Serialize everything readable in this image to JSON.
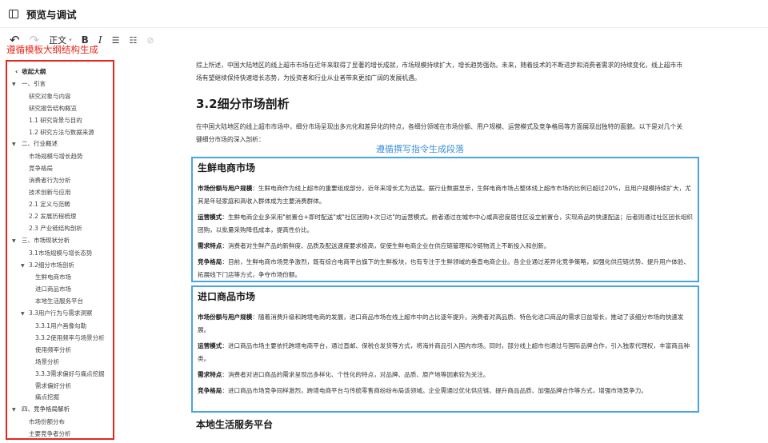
{
  "window": {
    "title": "预览与调试"
  },
  "toolbar": {
    "undo": "↶",
    "redo": "↷",
    "style_label": "正文",
    "style_caret": "▾",
    "bold": "B",
    "italic": "I",
    "bullet_list": "☰",
    "ordered_list": "☷",
    "link": "⊘"
  },
  "annotations": {
    "outline_note": "遵循模板大纲结构生成",
    "paragraph_note": "遵循撰写指令生成段落"
  },
  "outline": {
    "collapse_label": "收起大纲",
    "items": [
      {
        "level": "l1",
        "arrow": "▼",
        "label": "一、引言"
      },
      {
        "level": "l2",
        "label": "研究对象与内容"
      },
      {
        "level": "l2",
        "label": "研究报告结构概览"
      },
      {
        "level": "l2",
        "label": "1.1 研究背景与目的"
      },
      {
        "level": "l2",
        "label": "1.2 研究方法与数据来源"
      },
      {
        "level": "l1",
        "arrow": "▼",
        "label": "二、行业概述"
      },
      {
        "level": "l2",
        "label": "市场规模与增长趋势"
      },
      {
        "level": "l2",
        "label": "竞争格局"
      },
      {
        "level": "l2",
        "label": "消费者行为分析"
      },
      {
        "level": "l2",
        "label": "技术创新与应用"
      },
      {
        "level": "l2",
        "label": "2.1 定义与范畴"
      },
      {
        "level": "l2",
        "label": "2.2 发展历程梳理"
      },
      {
        "level": "l2",
        "label": "2.3 产业链结构剖析"
      },
      {
        "level": "l1",
        "arrow": "▼",
        "label": "三、市场现状分析"
      },
      {
        "level": "l2",
        "label": "3.1市场规模与增长态势"
      },
      {
        "level": "l2c",
        "arrow": "▼",
        "label": "3.2细分市场剖析"
      },
      {
        "level": "l3",
        "label": "生鲜电商市场"
      },
      {
        "level": "l3",
        "label": "进口商品市场"
      },
      {
        "level": "l3",
        "label": "本地生活服务平台"
      },
      {
        "level": "l2c",
        "arrow": "▼",
        "label": "3.3用户行为与需求洞察"
      },
      {
        "level": "l3",
        "label": "3.3.1用户画像勾勒"
      },
      {
        "level": "l3",
        "label": "3.3.2使用频率与场景分析"
      },
      {
        "level": "l3",
        "label": "使用频率分析"
      },
      {
        "level": "l3",
        "label": "场景分析"
      },
      {
        "level": "l3",
        "label": "3.3.3需求偏好与痛点挖掘"
      },
      {
        "level": "l3",
        "label": "需求偏好分析"
      },
      {
        "level": "l3",
        "label": "痛点挖掘"
      },
      {
        "level": "l1",
        "arrow": "▼",
        "label": "四、竞争格局解析"
      },
      {
        "level": "l2",
        "label": "市场份额分布"
      },
      {
        "level": "l2",
        "label": "主要竞争者分析"
      }
    ]
  },
  "doc": {
    "lead_paragraph": "综上所述，中国大陆地区的线上超市市场在近年来取得了显著的增长成就，市场规模持续扩大，增长趋势强劲。未来，随着技术的不断进步和消费者需求的持续变化，线上超市市场有望继续保持快速增长态势，为投资者和行业从业者带来更加广阔的发展机遇。",
    "section_title": "3.2细分市场剖析",
    "section_intro": "在中国大陆地区的线上超市市场中，细分市场呈现出多元化和差异化的特点，各细分领域在市场份额、用户规模、运营模式及竞争格局等方面展现出独特的面貌。以下是对几个关键细分市场的深入剖析：",
    "subsections": [
      {
        "title": "生鲜电商市场",
        "items": [
          {
            "label": "市场份额与用户规模",
            "text": "：生鲜电商作为线上超市的重要组成部分，近年来增长尤为迅猛。据行业数据显示，生鲜电商市场占整体线上超市市场的比例已超过20%，且用户规模持续扩大，尤其是年轻家庭和高收入群体成为主要消费群体。"
          },
          {
            "label": "运营模式",
            "text": "：生鲜电商企业多采用\"前置仓+即时配送\"或\"社区团购+次日达\"的运营模式。前者通过在城市中心或高密度居住区设立前置仓，实现商品的快速配送；后者则通过社区团长组织团购，以批量采购降低成本，提高性价比。"
          },
          {
            "label": "需求特点",
            "text": "：消费者对生鲜产品的新鲜度、品质及配送速度要求极高，促使生鲜电商企业在供应链管理和冷链物流上不断投入和创新。"
          },
          {
            "label": "竞争格局",
            "text": "：目前，生鲜电商市场竞争激烈，既有综合电商平台旗下的生鲜板块，也有专注于生鲜领域的垂直电商企业。各企业通过差异化竞争策略，如强化供应链优势、提升用户体验、拓展线下门店等方式，争夺市场份额。"
          }
        ]
      },
      {
        "title": "进口商品市场",
        "items": [
          {
            "label": "市场份额与用户规模",
            "text": "：随着消费升级和跨境电商的发展，进口商品市场在线上超市中的占比逐年提升。消费者对高品质、特色化进口商品的需求日益增长，推动了该细分市场的快速发展。"
          },
          {
            "label": "运营模式",
            "text": "：进口商品市场主要依托跨境电商平台，通过直邮、保税仓发货等方式，将海外商品引入国内市场。同时，部分线上超市也通过与国际品牌合作，引入独家代理权，丰富商品种类。"
          },
          {
            "label": "需求特点",
            "text": "：消费者对进口商品的需求呈现出多样化、个性化的特点，对品牌、品质、原产地等因素较为关注。"
          },
          {
            "label": "竞争格局",
            "text": "：进口商品市场竞争同样激烈，跨境电商平台与传统零售商纷纷布局该领域。企业需通过优化供应链、提升商品品质、加强品牌合作等方式，增强市场竞争力。"
          }
        ]
      }
    ],
    "next_subsection_title": "本地生活服务平台"
  }
}
